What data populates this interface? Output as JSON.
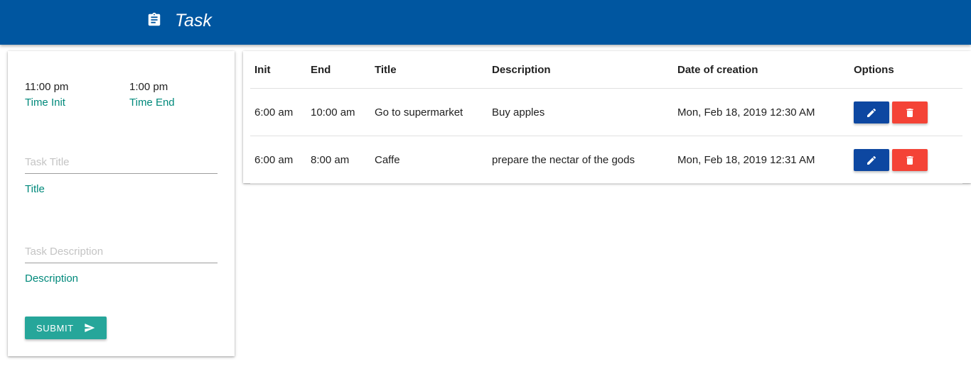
{
  "header": {
    "title": "Task",
    "icon": "clipboard-icon",
    "background": "#0056a0"
  },
  "form": {
    "time_init": {
      "value": "11:00 pm",
      "label": "Time Init"
    },
    "time_end": {
      "value": "1:00 pm",
      "label": "Time End"
    },
    "title_field": {
      "placeholder": "Task Title",
      "value": "",
      "hint": "Title"
    },
    "description_field": {
      "placeholder": "Task Description",
      "value": "",
      "hint": "Description"
    },
    "submit_label": "SUBMIT",
    "submit_icon": "send-icon",
    "accent": "#26a69a"
  },
  "table": {
    "columns": [
      "Init",
      "End",
      "Title",
      "Description",
      "Date of creation",
      "Options"
    ],
    "rows": [
      {
        "init": "6:00 am",
        "end": "10:00 am",
        "title": "Go to supermarket",
        "description": "Buy apples",
        "created": "Mon, Feb 18, 2019 12:30 AM"
      },
      {
        "init": "6:00 am",
        "end": "8:00 am",
        "title": "Caffe",
        "description": "prepare the nectar of the gods",
        "created": "Mon, Feb 18, 2019 12:31 AM"
      }
    ],
    "edit_icon": "pencil-icon",
    "delete_icon": "trash-icon",
    "edit_color": "#0d47a1",
    "delete_color": "#f44336"
  }
}
